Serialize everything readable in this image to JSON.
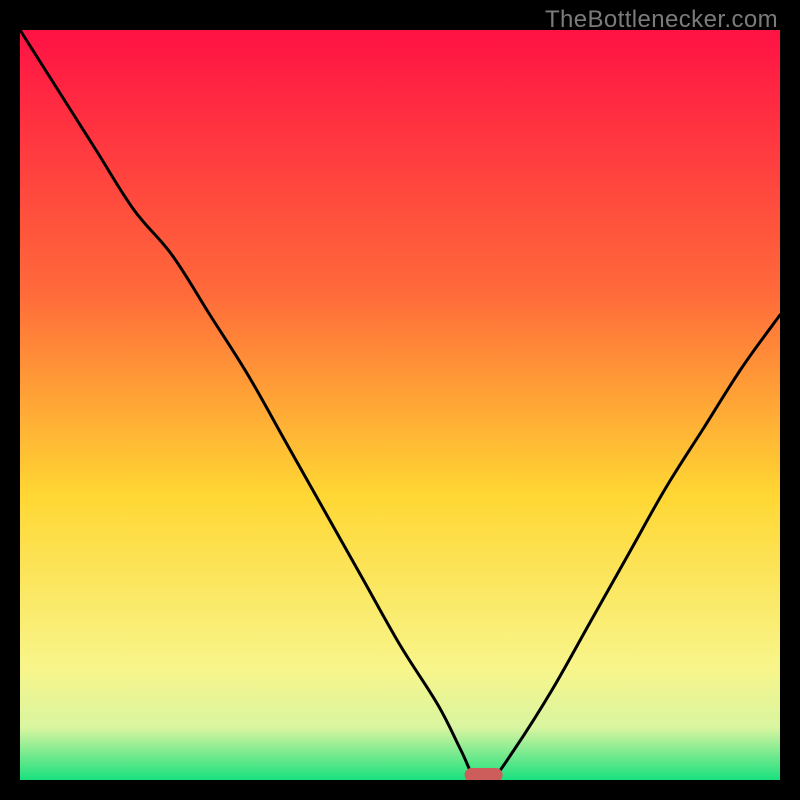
{
  "watermark": "TheBottlenecker.com",
  "colors": {
    "frame": "#000000",
    "curve": "#000000",
    "marker": "#cc5d5b",
    "gradient_top": "#ff1244",
    "gradient_mid1": "#ff6a3a",
    "gradient_mid2": "#ffd733",
    "gradient_mid3": "#f8f58a",
    "gradient_mid4": "#d9f5a0",
    "gradient_bottom": "#19e07e"
  },
  "chart_data": {
    "type": "line",
    "title": "",
    "xlabel": "",
    "ylabel": "",
    "xlim": [
      0,
      100
    ],
    "ylim": [
      0,
      100
    ],
    "grid": false,
    "legend": false,
    "series": [
      {
        "name": "bottleneck_curve",
        "x": [
          0,
          5,
          10,
          15,
          20,
          25,
          30,
          35,
          40,
          45,
          50,
          55,
          58,
          60,
          62,
          65,
          70,
          75,
          80,
          85,
          90,
          95,
          100
        ],
        "values": [
          100,
          92,
          84,
          76,
          70,
          62,
          54,
          45,
          36,
          27,
          18,
          10,
          4,
          0,
          0,
          4,
          12,
          21,
          30,
          39,
          47,
          55,
          62
        ]
      }
    ],
    "optimum_marker": {
      "x": 61,
      "y": 0,
      "width": 5,
      "height": 2
    },
    "annotations": []
  }
}
